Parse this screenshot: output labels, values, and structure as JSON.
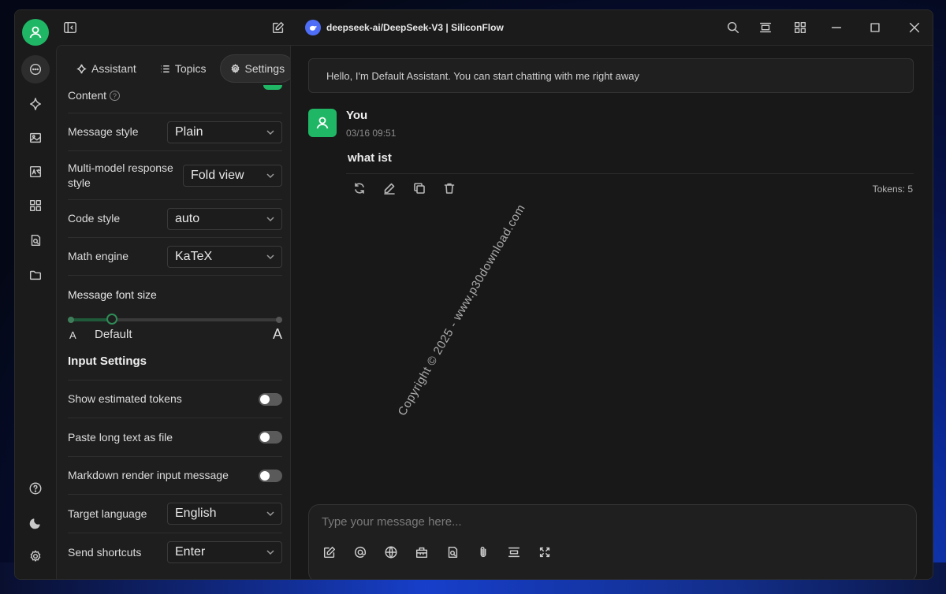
{
  "window": {
    "title": "deepseek-ai/DeepSeek-V3 | SiliconFlow"
  },
  "rail": {
    "items": [
      {
        "name": "chat-icon",
        "active": true
      },
      {
        "name": "sparkle-icon"
      },
      {
        "name": "image-icon"
      },
      {
        "name": "translate-icon"
      },
      {
        "name": "apps-icon"
      },
      {
        "name": "knowledge-icon"
      },
      {
        "name": "folder-icon"
      }
    ],
    "bottom": [
      {
        "name": "help-icon"
      },
      {
        "name": "theme-moon-icon"
      },
      {
        "name": "settings-gear-icon"
      }
    ]
  },
  "sidebar": {
    "tabs": [
      {
        "label": "Assistant",
        "icon": "sparkle-icon"
      },
      {
        "label": "Topics",
        "icon": "list-icon"
      },
      {
        "label": "Settings",
        "icon": "gear-icon",
        "active": true
      }
    ],
    "partial_label": "Content",
    "rows": {
      "message_style": {
        "label": "Message style",
        "value": "Plain"
      },
      "multi_model": {
        "label": "Multi-model response style",
        "value": "Fold view"
      },
      "code_style": {
        "label": "Code style",
        "value": "auto"
      },
      "math_engine": {
        "label": "Math engine",
        "value": "KaTeX"
      },
      "font_size": {
        "label": "Message font size",
        "small_marker": "A",
        "default_label": "Default",
        "large_marker": "A",
        "level": 0.2
      }
    },
    "input_settings": {
      "title": "Input Settings",
      "show_tokens": {
        "label": "Show estimated tokens",
        "on": false
      },
      "paste_as_file": {
        "label": "Paste long text as file",
        "on": false
      },
      "markdown_input": {
        "label": "Markdown render input message",
        "on": false
      },
      "target_language": {
        "label": "Target language",
        "value": "English"
      },
      "send_shortcuts": {
        "label": "Send shortcuts",
        "value": "Enter"
      }
    }
  },
  "main": {
    "banner": "Hello, I'm Default Assistant. You can start chatting with me right away",
    "message": {
      "author": "You",
      "time": "03/16 09:51",
      "text": "what ist",
      "tokens": "Tokens: 5"
    },
    "watermark": "Copyright © 2025 - www.p30download.com",
    "composer": {
      "placeholder": "Type your message here..."
    }
  },
  "colors": {
    "accent": "#1fb765",
    "window_bg": "#1b1b1b"
  }
}
